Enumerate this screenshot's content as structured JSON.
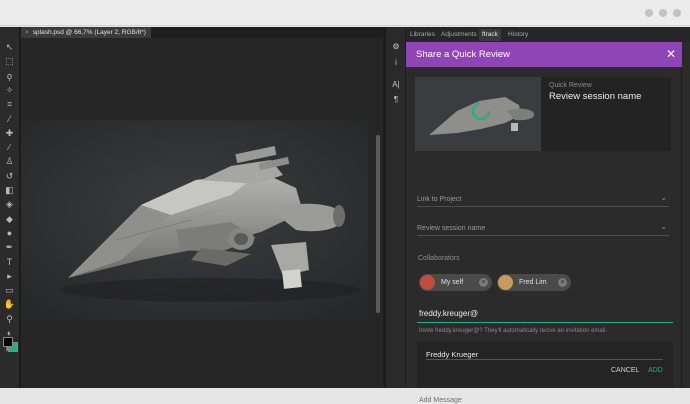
{
  "window": {
    "dots": [
      "minimize",
      "maximize",
      "close"
    ]
  },
  "document": {
    "tab_title": "splash.psd @ 66,7% (Layer 2, RGB/8*)",
    "close_glyph": "×"
  },
  "tools": [
    {
      "name": "move-tool-icon",
      "glyph": "↖"
    },
    {
      "name": "marquee-tool-icon",
      "glyph": "⬚"
    },
    {
      "name": "lasso-tool-icon",
      "glyph": "ϙ"
    },
    {
      "name": "magic-wand-tool-icon",
      "glyph": "✧"
    },
    {
      "name": "crop-tool-icon",
      "glyph": "⌗"
    },
    {
      "name": "eyedropper-tool-icon",
      "glyph": "⁄"
    },
    {
      "name": "healing-brush-tool-icon",
      "glyph": "✚"
    },
    {
      "name": "brush-tool-icon",
      "glyph": "∕"
    },
    {
      "name": "stamp-tool-icon",
      "glyph": "♙"
    },
    {
      "name": "history-brush-tool-icon",
      "glyph": "↺"
    },
    {
      "name": "eraser-tool-icon",
      "glyph": "◧"
    },
    {
      "name": "paint-bucket-tool-icon",
      "glyph": "◈"
    },
    {
      "name": "blur-tool-icon",
      "glyph": "◆"
    },
    {
      "name": "dodge-tool-icon",
      "glyph": "●"
    },
    {
      "name": "pen-tool-icon",
      "glyph": "✒"
    },
    {
      "name": "type-tool-icon",
      "glyph": "T"
    },
    {
      "name": "path-selection-tool-icon",
      "glyph": "▸"
    },
    {
      "name": "rectangle-tool-icon",
      "glyph": "▭"
    },
    {
      "name": "hand-tool-icon",
      "glyph": "✋"
    },
    {
      "name": "zoom-tool-icon",
      "glyph": "⚲"
    },
    {
      "name": "quick-mask-icon",
      "glyph": "◐"
    },
    {
      "name": "screen-mode-icon",
      "glyph": "▣"
    }
  ],
  "colors": {
    "foreground": "#000000",
    "background": "#1fb086",
    "accent": "#8f45b6",
    "add": "#1fb086"
  },
  "side_icons": [
    {
      "name": "properties-icon",
      "glyph": "⚙"
    },
    {
      "name": "info-icon",
      "glyph": "i"
    },
    {
      "name": "character-icon",
      "glyph": "A|"
    },
    {
      "name": "paragraph-icon",
      "glyph": "¶"
    }
  ],
  "panel_tabs": [
    {
      "label": "Libraries",
      "active": false
    },
    {
      "label": "Adjustments",
      "active": false
    },
    {
      "label": "ftrack",
      "active": true
    },
    {
      "label": "History",
      "active": false
    }
  ],
  "review": {
    "header": "Share a Quick Review",
    "close_glyph": "✕",
    "thumb_subtitle": "Quick Review",
    "thumb_title": "Review session name",
    "link_label": "Link to Project",
    "name_label": "Review session name",
    "collaborators_label": "Collaborators",
    "collaborators": [
      {
        "name": "My self",
        "avatar_color": "#c24d3b"
      },
      {
        "name": "Fred Lim",
        "avatar_color": "#c89a5c"
      }
    ],
    "chip_remove_glyph": "×",
    "chevron": "⌄",
    "email_value": "freddy.kreuger@",
    "hint": "Invite freddy.kreuger@? They'll automatically recive an invitation email.",
    "name_value": "Freddy Krueger",
    "cancel": "CANCEL",
    "add": "ADD",
    "message_placeholder": "Add Message"
  }
}
